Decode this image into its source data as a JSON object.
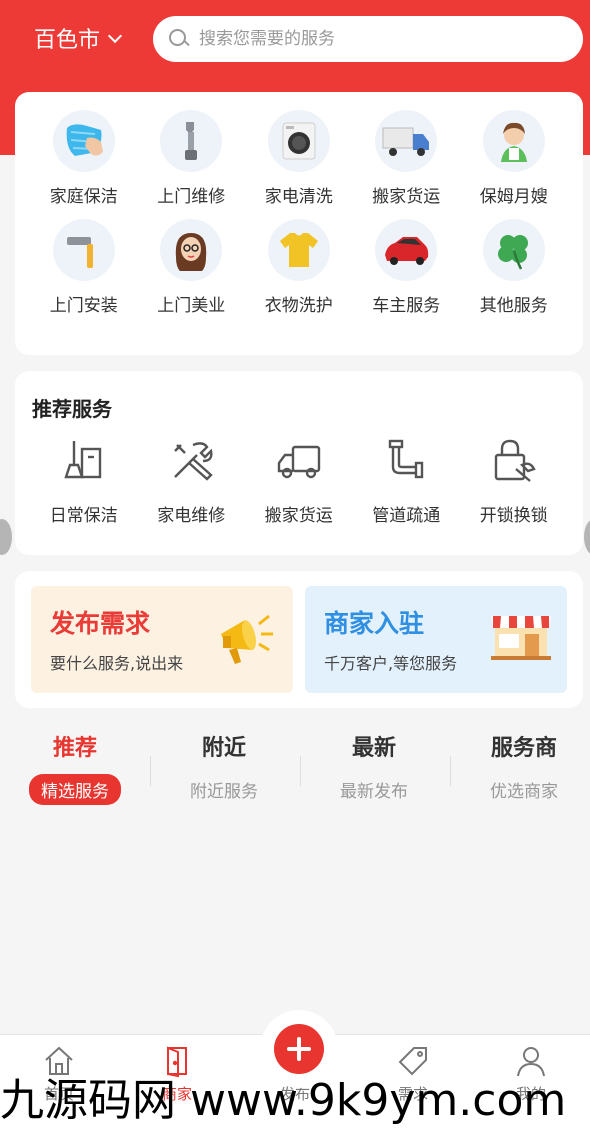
{
  "header": {
    "city": "百色市",
    "search_placeholder": "搜索您需要的服务"
  },
  "categories": [
    {
      "label": "家庭保洁",
      "icon": "cleaning-cloth-icon"
    },
    {
      "label": "上门维修",
      "icon": "wrench-icon"
    },
    {
      "label": "家电清洗",
      "icon": "washing-machine-icon"
    },
    {
      "label": "搬家货运",
      "icon": "truck-icon"
    },
    {
      "label": "保姆月嫂",
      "icon": "nanny-icon"
    },
    {
      "label": "上门安装",
      "icon": "hammer-icon"
    },
    {
      "label": "上门美业",
      "icon": "beauty-girl-icon"
    },
    {
      "label": "衣物洗护",
      "icon": "tshirt-icon"
    },
    {
      "label": "车主服务",
      "icon": "car-icon"
    },
    {
      "label": "其他服务",
      "icon": "clover-icon"
    }
  ],
  "recommend": {
    "title": "推荐服务",
    "items": [
      {
        "label": "日常保洁",
        "icon": "broom-bucket-icon"
      },
      {
        "label": "家电维修",
        "icon": "tools-icon"
      },
      {
        "label": "搬家货运",
        "icon": "delivery-truck-icon"
      },
      {
        "label": "管道疏通",
        "icon": "pipe-icon"
      },
      {
        "label": "开锁换锁",
        "icon": "lock-wrench-icon"
      }
    ]
  },
  "promo": {
    "publish": {
      "title": "发布需求",
      "subtitle": "要什么服务,说出来",
      "icon": "megaphone-icon"
    },
    "merchant": {
      "title": "商家入驻",
      "subtitle": "千万客户,等您服务",
      "icon": "shop-icon"
    }
  },
  "tabs": [
    {
      "name": "推荐",
      "sub": "精选服务",
      "active": true
    },
    {
      "name": "附近",
      "sub": "附近服务",
      "active": false
    },
    {
      "name": "最新",
      "sub": "最新发布",
      "active": false
    },
    {
      "name": "服务商",
      "sub": "优选商家",
      "active": false
    }
  ],
  "bottom_nav": [
    {
      "label": "首页",
      "icon": "home-icon"
    },
    {
      "label": "商家",
      "icon": "door-icon",
      "active": true
    },
    {
      "label": "发布",
      "icon": "plus-icon"
    },
    {
      "label": "需求",
      "icon": "tag-icon"
    },
    {
      "label": "我的",
      "icon": "user-icon"
    }
  ],
  "watermark": "九源码网 www.9k9ym.com",
  "colors": {
    "primary": "#ee3a36",
    "merchant_blue": "#2f8fe3",
    "background": "#f5f5f5"
  }
}
